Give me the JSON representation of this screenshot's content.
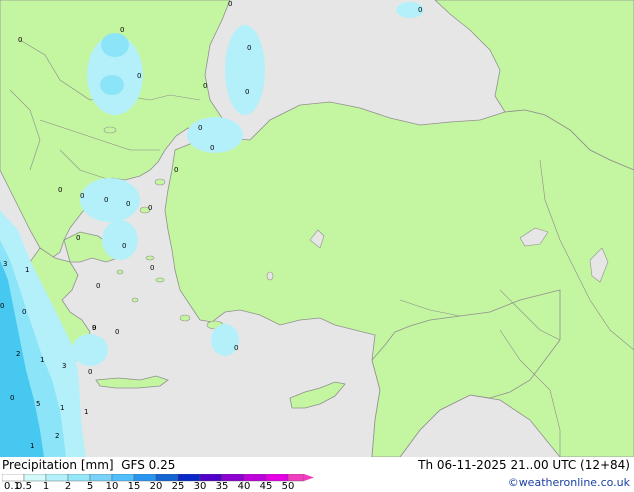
{
  "title": {
    "product": "Precipitation [mm]",
    "model": "GFS 0.25",
    "valid_time": "Th 06-11-2025 21..00 UTC (12+84)",
    "credit": "©weatheronline.co.uk"
  },
  "colors": {
    "sea": "#e6e6e6",
    "land_fill": "#c4f5a0",
    "coastline": "#909090",
    "border": "#8c8c8c",
    "precip_light": "#b4f0fa",
    "precip_medium": "#8ce4f8",
    "precip_heavy": "#46c8f0"
  },
  "legend": {
    "levels": [
      "0.1",
      "0.5",
      "1",
      "2",
      "5",
      "10",
      "15",
      "20",
      "25",
      "30",
      "35",
      "40",
      "45",
      "50"
    ],
    "colors": [
      "#ffffff",
      "#d2fafa",
      "#b4f0fa",
      "#96e6fa",
      "#78d2fa",
      "#50beff",
      "#2896f0",
      "#1464d2",
      "#0a28c8",
      "#5000c8",
      "#8c00d2",
      "#be00dc",
      "#e600e6",
      "#f03cbe"
    ]
  },
  "map_values": [
    {
      "v": "0"
    },
    {
      "v": "0"
    },
    {
      "v": "0"
    },
    {
      "v": "0"
    },
    {
      "v": "0"
    },
    {
      "v": "0"
    },
    {
      "v": "0"
    },
    {
      "v": "0"
    },
    {
      "v": "0"
    },
    {
      "v": "0"
    },
    {
      "v": "0"
    },
    {
      "v": "0"
    },
    {
      "v": "0"
    },
    {
      "v": "0"
    },
    {
      "v": "0"
    },
    {
      "v": "0"
    },
    {
      "v": "0"
    },
    {
      "v": "3"
    },
    {
      "v": "1"
    },
    {
      "v": "0"
    },
    {
      "v": "0"
    },
    {
      "v": "2"
    },
    {
      "v": "1"
    },
    {
      "v": "3"
    },
    {
      "v": "0"
    },
    {
      "v": "0"
    },
    {
      "v": "5"
    },
    {
      "v": "1"
    },
    {
      "v": "1"
    },
    {
      "v": "1"
    },
    {
      "v": "2"
    },
    {
      "v": "9"
    },
    {
      "v": "0"
    },
    {
      "v": "0"
    },
    {
      "v": "0"
    },
    {
      "v": "0"
    },
    {
      "v": "0"
    },
    {
      "v": "0"
    }
  ]
}
